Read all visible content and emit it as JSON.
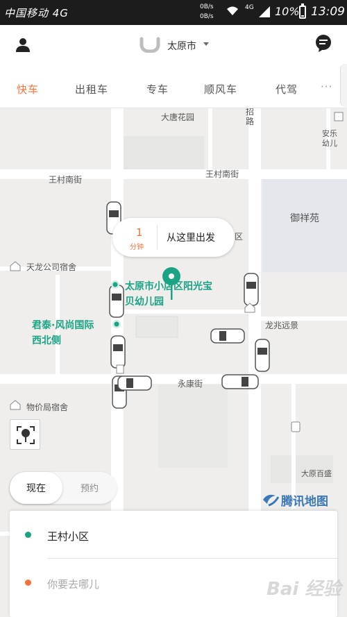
{
  "status_bar": {
    "carrier": "中国移动 4G",
    "net_up": "0B/s",
    "net_down": "0B/s",
    "network_type": "4G",
    "battery": "10%",
    "time": "13:09"
  },
  "header": {
    "city": "太原市"
  },
  "tabs": [
    {
      "label": "快车",
      "active": true
    },
    {
      "label": "出租车",
      "active": false
    },
    {
      "label": "专车",
      "active": false
    },
    {
      "label": "顺风车",
      "active": false
    },
    {
      "label": "代驾",
      "active": false
    }
  ],
  "map": {
    "labels": {
      "datang_garden": "大唐花园",
      "road_top": "路",
      "road_top2": "招",
      "wangcun_south_left": "王村南街",
      "wangcun_south_right": "王村南街",
      "yuxiang_garden": "御祥苑",
      "tianlong_dorm": "天龙公司宿舍",
      "longzhao_yuan": "龙兆远景",
      "yongkang_street": "永康街",
      "wujia_dorm": "物价局宿舍",
      "anle_kindergarten": "安乐幼儿",
      "district_fragment": "区",
      "taiyuan_baicheng": "大原百盛"
    },
    "poi": {
      "kindergarten": "太原市小店区阳光宝贝幼儿园",
      "kindergarten_line1": "太原市小店区阳光宝",
      "kindergarten_line2": "贝幼儿园",
      "junta_line1": "君泰·风尚国际",
      "junta_line2": "西北侧"
    },
    "eta": {
      "minutes": "1",
      "unit": "分钟",
      "cta": "从这里出发"
    },
    "attribution": "腾讯地图"
  },
  "time_toggle": {
    "now": "现在",
    "book": "预约"
  },
  "address": {
    "from": "王村小区",
    "to_placeholder": "你要去哪儿"
  },
  "watermark": "Bai 经验",
  "colors": {
    "accent_orange": "#f5733a",
    "pickup_green": "#1aa385",
    "map_bg": "#efeeec",
    "road": "#ffffff"
  }
}
